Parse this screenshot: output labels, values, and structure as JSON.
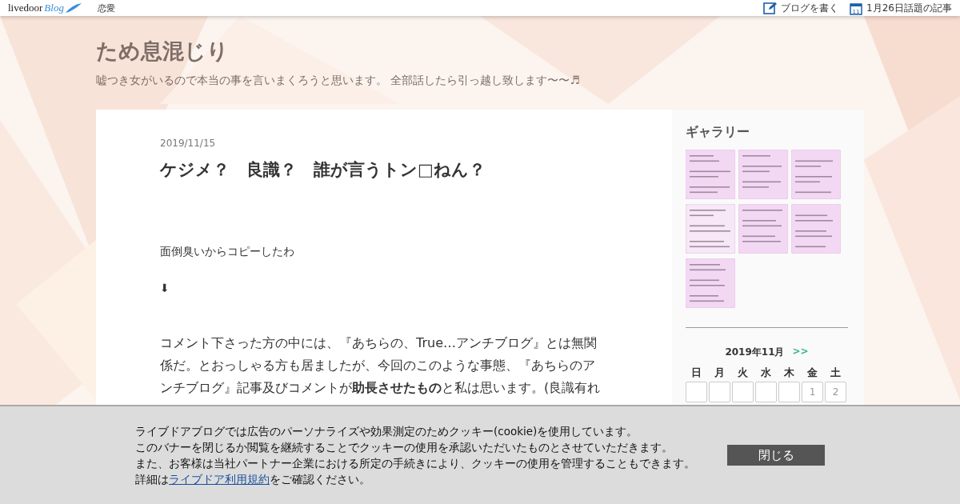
{
  "topbar": {
    "logo_text": "livedoor",
    "logo_script": "Blog",
    "category": "恋愛",
    "links": [
      {
        "kind": "write",
        "label": "ブログを書く"
      },
      {
        "kind": "calendar",
        "label": "1月26日話題の記事",
        "day": "11"
      }
    ]
  },
  "blog": {
    "title": "ため息混じり",
    "description": "嘘つき女がいるので本当の事を言いまくろうと思います。 全部話したら引っ越し致します〜〜♬"
  },
  "article": {
    "date": "2019/11/15",
    "title": "ケジメ？　良識？　誰が言うトン□ねん？",
    "paragraphs": [
      "面倒臭いからコピーしたわ",
      "⬇",
      "コメント下さった方の中には、『あちらの、True…アンチブログ』とは無関係だ。とおっしゃる方も居ましたが、今回のこのような事態、『あちらのアンチブログ』記事及びコメントが**助長させたもの**と私は思います。(良識有れ"
    ]
  },
  "sidebar": {
    "gallery": {
      "title": "ギャラリー"
    },
    "calendar": {
      "month": "2019年11月",
      "next": ">>",
      "weekdays": [
        "日",
        "月",
        "火",
        "水",
        "木",
        "金",
        "土"
      ],
      "first_week": [
        {
          "kind": "blank"
        },
        {
          "kind": "blank"
        },
        {
          "kind": "blank"
        },
        {
          "kind": "blank"
        },
        {
          "kind": "blank"
        },
        {
          "kind": "day",
          "label": "1"
        },
        {
          "kind": "day",
          "label": "2"
        }
      ]
    }
  },
  "cookie_banner": {
    "lines": [
      "ライブドアブログでは広告のパーソナライズや効果測定のためクッキー(cookie)を使用しています。",
      "このバナーを閉じるか閲覧を継続することでクッキーの使用を承認いただいたものとさせていただきます。",
      "また、お客様は当社パートナー企業における所定の手続きにより、クッキーの使用を管理することもできます。"
    ],
    "detail_prefix": "詳細は",
    "detail_link": "ライブドア利用規約",
    "detail_suffix": "をご確認ください。",
    "close_button": "閉じる"
  }
}
